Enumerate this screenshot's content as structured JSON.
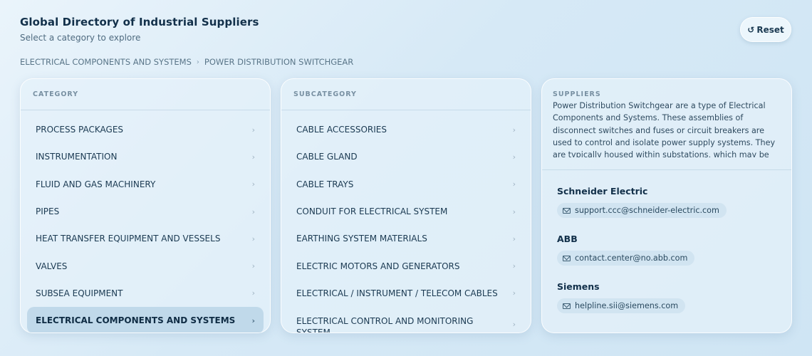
{
  "header": {
    "title": "Global Directory of Industrial Suppliers",
    "subtitle": "Select a category to explore",
    "reset_label": "Reset",
    "reset_icon": "↺"
  },
  "breadcrumb": {
    "items": [
      "ELECTRICAL COMPONENTS AND SYSTEMS",
      "POWER DISTRIBUTION SWITCHGEAR"
    ],
    "separator": "›"
  },
  "category": {
    "heading": "CATEGORY",
    "items": [
      "PROCESS PACKAGES",
      "INSTRUMENTATION",
      "FLUID AND GAS MACHINERY",
      "PIPES",
      "HEAT TRANSFER EQUIPMENT AND VESSELS",
      "VALVES",
      "SUBSEA EQUIPMENT",
      "ELECTRICAL COMPONENTS AND SYSTEMS"
    ],
    "active_index": 7
  },
  "subcategory": {
    "heading": "SUBCATEGORY",
    "items": [
      "CABLE ACCESSORIES",
      "CABLE GLAND",
      "CABLE TRAYS",
      "CONDUIT FOR ELECTRICAL SYSTEM",
      "EARTHING SYSTEM MATERIALS",
      "ELECTRIC MOTORS AND GENERATORS",
      "ELECTRICAL / INSTRUMENT / TELECOM CABLES",
      "ELECTRICAL CONTROL AND MONITORING SYSTEM"
    ]
  },
  "suppliers": {
    "heading": "SUPPLIERS",
    "description": "Power Distribution Switchgear are a type of Electrical Components and Systems. These assemblies of disconnect switches and fuses or circuit breakers are used to control and isolate power supply systems. They are typically housed within substations, which may be indoor or outdoor",
    "list": [
      {
        "name": "Schneider Electric",
        "email": "support.ccc@schneider-electric.com"
      },
      {
        "name": "ABB",
        "email": "contact.center@no.abb.com"
      },
      {
        "name": "Siemens",
        "email": "helpline.sii@siemens.com"
      }
    ]
  },
  "chevron": "›"
}
